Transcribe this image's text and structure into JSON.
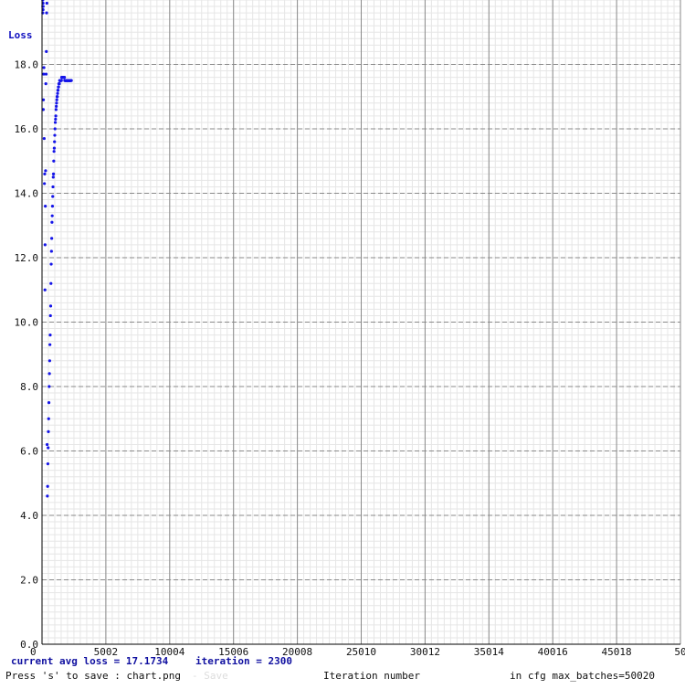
{
  "chart_data": {
    "type": "scatter",
    "title": "",
    "ylabel": "Loss",
    "xlabel": "Iteration number",
    "xlim": [
      0,
      50020
    ],
    "ylim": [
      0,
      20
    ],
    "grid": true,
    "x_ticks": [
      {
        "value": 0,
        "label": "0"
      },
      {
        "value": 5002,
        "label": "5002"
      },
      {
        "value": 10004,
        "label": "10004"
      },
      {
        "value": 15006,
        "label": "15006"
      },
      {
        "value": 20008,
        "label": "20008"
      },
      {
        "value": 25010,
        "label": "25010"
      },
      {
        "value": 30012,
        "label": "30012"
      },
      {
        "value": 35014,
        "label": "35014"
      },
      {
        "value": 40016,
        "label": "40016"
      },
      {
        "value": 45018,
        "label": "45018"
      },
      {
        "value": 50020,
        "label": "50"
      }
    ],
    "y_ticks": [
      {
        "value": 0,
        "label": "0.0"
      },
      {
        "value": 2,
        "label": "2.0"
      },
      {
        "value": 4,
        "label": "4.0"
      },
      {
        "value": 6,
        "label": "6.0"
      },
      {
        "value": 8,
        "label": "8.0"
      },
      {
        "value": 10,
        "label": "10.0"
      },
      {
        "value": 12,
        "label": "12.0"
      },
      {
        "value": 14,
        "label": "14.0"
      },
      {
        "value": 16,
        "label": "16.0"
      },
      {
        "value": 18,
        "label": "18.0"
      }
    ],
    "series": [
      {
        "color": "#1515e8",
        "x": [
          60,
          60,
          60,
          80,
          80,
          90,
          100,
          110,
          130,
          150,
          170,
          190,
          210,
          230,
          240,
          260,
          280,
          300,
          320,
          340,
          360,
          380,
          400,
          420,
          440,
          460,
          480,
          500,
          520,
          540,
          560,
          580,
          600,
          620,
          640,
          660,
          680,
          700,
          720,
          740,
          760,
          780,
          800,
          820,
          840,
          860,
          880,
          900,
          920,
          940,
          960,
          980,
          1000,
          1020,
          1040,
          1060,
          1080,
          1100,
          1120,
          1140,
          1160,
          1180,
          1200,
          1220,
          1240,
          1260,
          1280,
          1300,
          1320,
          1340,
          1360,
          1380,
          1400,
          1420,
          1440,
          1460,
          1480,
          1500,
          1520,
          1540,
          1560,
          1580,
          1600,
          1620,
          1640,
          1660,
          1680,
          1700,
          1720,
          1740,
          1760,
          1780,
          1800,
          1820,
          1840,
          1860,
          1880,
          1900,
          1920,
          1940,
          1960,
          1980,
          2000,
          2020,
          2040,
          2060,
          2080,
          2100,
          2120,
          2140,
          2160,
          2180,
          2200,
          2220,
          2240,
          2260,
          2280,
          2300
        ],
        "y": [
          20,
          19.6,
          19.8,
          19.7,
          19.9,
          19.8,
          16.6,
          16.9,
          17.7,
          17.9,
          15.7,
          14.3,
          14.6,
          11.0,
          12.4,
          13.6,
          14.7,
          17.4,
          17.7,
          18.4,
          19.6,
          19.9,
          6.2,
          4.6,
          4.9,
          5.6,
          6.1,
          6.6,
          7.0,
          7.5,
          8.0,
          8.4,
          8.8,
          9.3,
          9.6,
          10.2,
          10.5,
          11.2,
          11.8,
          12.2,
          12.6,
          13.1,
          13.3,
          13.6,
          13.9,
          14.2,
          14.5,
          14.6,
          15.0,
          15.3,
          15.4,
          15.6,
          15.8,
          16.0,
          16.2,
          16.3,
          16.4,
          16.6,
          16.7,
          16.8,
          16.9,
          17.0,
          17.0,
          17.1,
          17.2,
          17.2,
          17.3,
          17.3,
          17.4,
          17.4,
          17.4,
          17.5,
          17.5,
          17.5,
          17.5,
          17.5,
          17.5,
          17.5,
          17.5,
          17.6,
          17.6,
          17.6,
          17.6,
          17.6,
          17.6,
          17.6,
          17.6,
          17.6,
          17.6,
          17.6,
          17.6,
          17.5,
          17.5,
          17.5,
          17.5,
          17.5,
          17.5,
          17.5,
          17.5,
          17.5,
          17.5,
          17.5,
          17.5,
          17.5,
          17.5,
          17.5,
          17.5,
          17.5,
          17.5,
          17.5,
          17.5,
          17.5,
          17.5,
          17.5,
          17.5,
          17.5,
          17.5,
          17.5
        ]
      }
    ]
  },
  "footer": {
    "status_loss": "current avg loss = 17.1734",
    "status_iteration": "iteration = 2300",
    "save_hint": "Press 's' to save : chart.png",
    "ghost_text": "- Save",
    "max_batches": "in cfg max_batches=50020"
  }
}
